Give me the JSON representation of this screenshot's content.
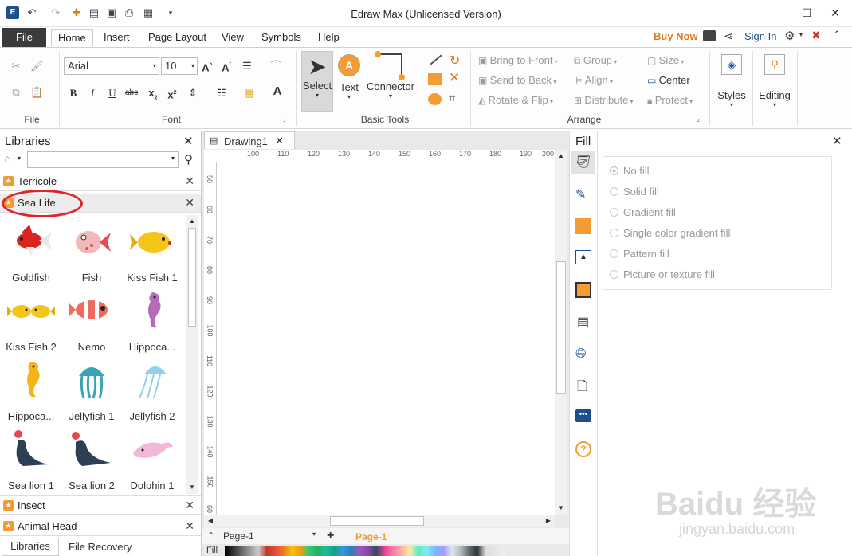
{
  "app": {
    "title": "Edraw Max (Unlicensed Version)"
  },
  "window_controls": {
    "minimize": "—",
    "maximize": "☐",
    "close": "✕"
  },
  "menu": {
    "file": "File",
    "tabs": [
      "Home",
      "Insert",
      "Page Layout",
      "View",
      "Symbols",
      "Help"
    ],
    "buy_now": "Buy Now",
    "sign_in": "Sign In"
  },
  "ribbon": {
    "groups": {
      "file": "File",
      "font": "Font",
      "basic_tools": "Basic Tools",
      "arrange": "Arrange"
    },
    "font_name": "Arial",
    "font_size": "10",
    "tools": {
      "select": "Select",
      "text": "Text",
      "connector": "Connector"
    },
    "arrange": {
      "bring_to_front": "Bring to Front",
      "send_to_back": "Send to Back",
      "rotate_flip": "Rotate & Flip",
      "group": "Group",
      "align": "Align",
      "distribute": "Distribute",
      "size": "Size",
      "center": "Center",
      "protect": "Protect"
    },
    "styles": "Styles",
    "editing": "Editing"
  },
  "libraries": {
    "title": "Libraries",
    "search_placeholder": "",
    "top_items": [
      "Terricole",
      "Sea Life"
    ],
    "shapes": [
      {
        "name": "Goldfish",
        "icon": "goldfish-icon"
      },
      {
        "name": "Fish",
        "icon": "fish-icon"
      },
      {
        "name": "Kiss Fish 1",
        "icon": "kiss-fish-icon"
      },
      {
        "name": "Kiss Fish 2",
        "icon": "kiss-fish-pair-icon"
      },
      {
        "name": "Nemo",
        "icon": "clownfish-icon"
      },
      {
        "name": "Hippoca...",
        "icon": "seahorse-icon"
      },
      {
        "name": "Hippoca...",
        "icon": "seahorse-yellow-icon"
      },
      {
        "name": "Jellyfish 1",
        "icon": "jellyfish-icon"
      },
      {
        "name": "Jellyfish 2",
        "icon": "jellyfish-blue-icon"
      },
      {
        "name": "Sea lion 1",
        "icon": "sea-lion-icon"
      },
      {
        "name": "Sea lion 2",
        "icon": "sea-lion-ball-icon"
      },
      {
        "name": "Dolphin 1",
        "icon": "dolphin-icon"
      }
    ],
    "bottom_items": [
      "Insect",
      "Animal Head"
    ],
    "bottom_tabs": [
      "Libraries",
      "File Recovery"
    ]
  },
  "canvas": {
    "tab": "Drawing1",
    "ruler_h": [
      "100",
      "110",
      "120",
      "130",
      "140",
      "150",
      "160",
      "170",
      "180",
      "190",
      "200"
    ],
    "ruler_v": [
      "50",
      "60",
      "70",
      "80",
      "90",
      "100",
      "110",
      "120",
      "130",
      "140",
      "150",
      "60"
    ],
    "page_select": "Page-1",
    "page_tab": "Page-1",
    "fill_label": "Fill"
  },
  "fill_panel": {
    "title": "Fill",
    "options": [
      "No fill",
      "Solid fill",
      "Gradient fill",
      "Single color gradient fill",
      "Pattern fill",
      "Picture or texture fill"
    ]
  },
  "watermark": {
    "logo": "Baidu 经验",
    "url": "jingyan.baidu.com"
  },
  "colors": {
    "accent": "#f39c33",
    "highlight_circle": "#e0242b",
    "file_tab": "#3a3a3a"
  }
}
